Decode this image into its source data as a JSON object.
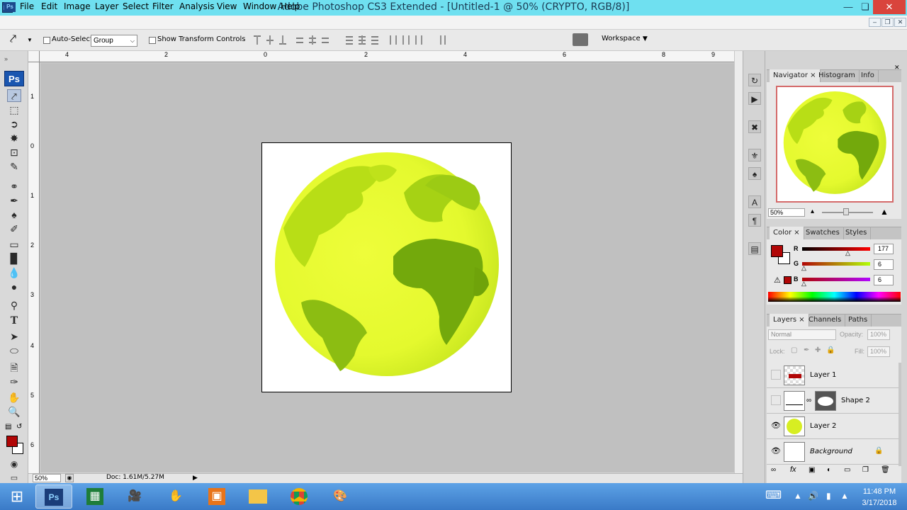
{
  "window": {
    "title": "Adobe Photoshop CS3 Extended - [Untitled-1 @ 50% (CRYPTO, RGB/8)]",
    "app_icon": "Ps"
  },
  "menu": [
    "File",
    "Edit",
    "Image",
    "Layer",
    "Select",
    "Filter",
    "Analysis",
    "View",
    "Window",
    "Help"
  ],
  "options": {
    "auto_select_label": "Auto-Select:",
    "auto_select_value": "Group",
    "transform_label": "Show Transform Controls",
    "workspace_label": "Workspace"
  },
  "rulers": {
    "top": [
      "4",
      "2",
      "0",
      "2",
      "4",
      "6",
      "8",
      "9"
    ],
    "left": [
      "1",
      "0",
      "1",
      "2",
      "3",
      "4",
      "5",
      "6"
    ]
  },
  "toolbar": {
    "logo": "Ps"
  },
  "status": {
    "zoom": "50%",
    "doc": "Doc: 1.61M/5.27M"
  },
  "navigator": {
    "tabs": [
      "Navigator",
      "Histogram",
      "Info"
    ],
    "zoom": "50%"
  },
  "color_panel": {
    "tabs": [
      "Color",
      "Swatches",
      "Styles"
    ],
    "r_label": "R",
    "g_label": "G",
    "b_label": "B",
    "r": "177",
    "g": "6",
    "b": "6",
    "fg": "#b10606"
  },
  "layers_panel": {
    "tabs": [
      "Layers",
      "Channels",
      "Paths"
    ],
    "blend_mode": "Normal",
    "opacity_label": "Opacity:",
    "opacity": "100%",
    "lock_label": "Lock:",
    "fill_label": "Fill:",
    "fill": "100%",
    "layers": [
      {
        "name": "Layer 1",
        "visible": false
      },
      {
        "name": "Shape 2",
        "visible": false
      },
      {
        "name": "Layer 2",
        "visible": true
      },
      {
        "name": "Background",
        "visible": true
      }
    ]
  },
  "taskbar": {
    "time": "11:48 PM",
    "date": "3/17/2018"
  },
  "colors": {
    "globe_light": "#e6fb33",
    "globe_land": "#8fc31a",
    "accent": "#1a56b0"
  }
}
